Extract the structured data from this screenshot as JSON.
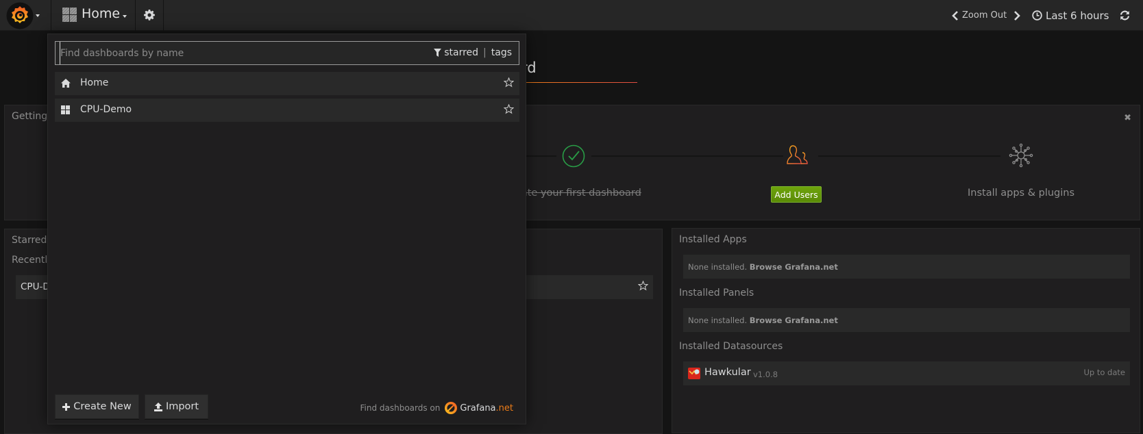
{
  "navbar": {
    "dashboard_title": "Home",
    "zoom_out_label": "Zoom Out",
    "time_range_label": "Last 6 hours",
    "icons": {
      "logo": "grafana-logo-icon",
      "dashboard": "dashboard-grid-icon",
      "settings": "gear-icon",
      "zoom_prev": "chevron-left-icon",
      "zoom_next": "chevron-right-icon",
      "time": "clock-icon",
      "refresh": "refresh-icon"
    }
  },
  "dashboard": {
    "title": "Home Dashboard",
    "getting_started": {
      "title": "Getting Started",
      "close_label": "✖",
      "steps": [
        {
          "label": "Create your first dashboard",
          "done": true,
          "icon": "check-circle-icon"
        },
        {
          "label": "Add Users",
          "button": true,
          "icon": "users-icon"
        },
        {
          "label": "Install apps & plugins",
          "icon": "plugins-icon"
        }
      ]
    },
    "starred": {
      "title": "Starred dashboards",
      "recent_title": "Recently viewed dashboards",
      "recent_items": [
        {
          "name": "CPU-Demo"
        }
      ]
    },
    "plugins": {
      "apps_title": "Installed Apps",
      "panels_title": "Installed Panels",
      "datasources_title": "Installed Datasources",
      "none_text": "None installed.",
      "browse_link": "Browse Grafana.net",
      "datasources": [
        {
          "name": "Hawkular",
          "version": "v1.0.8",
          "status": "Up to date"
        }
      ]
    }
  },
  "search": {
    "placeholder": "Find dashboards by name",
    "value": "",
    "filter_starred": "starred",
    "filter_sep": "|",
    "filter_tags": "tags",
    "results": [
      {
        "name": "Home",
        "icon": "home-icon",
        "starred": false
      },
      {
        "name": "CPU-Demo",
        "icon": "dashboard-grid-icon",
        "starred": false
      }
    ],
    "create_new_label": "Create New",
    "import_label": "Import",
    "find_on_label": "Find dashboards on",
    "grafana_net_label": "Grafana",
    "grafana_net_suffix": ".net"
  },
  "colors": {
    "accent_orange": "#eb7b18",
    "success_green": "#299c46",
    "button_green": "#6ea40c"
  }
}
